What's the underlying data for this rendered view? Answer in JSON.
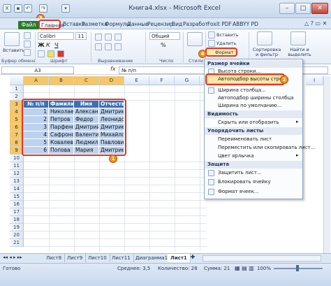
{
  "window": {
    "title": "Книга4.xlsx - Microsoft Excel",
    "min": "–",
    "max": "□",
    "close": "✕"
  },
  "ribbon_tabs": {
    "file": "Файл",
    "items": [
      "Главная",
      "Вставка",
      "Разметка",
      "Формулы",
      "Данные",
      "Рецензир",
      "Вид",
      "Разработ",
      "Foxit PDF",
      "ABBYY PD"
    ]
  },
  "ribbon": {
    "paste": "Вставить",
    "clipboard_group": "Буфер обмена",
    "font_name": "Calibri",
    "font_size": "11",
    "font_group": "Шрифт",
    "align_group": "Выравнивание",
    "number_format": "Общий",
    "number_group": "Число",
    "styles": "Стили",
    "insert": "Вставить",
    "delete": "Удалить",
    "format": "Формат",
    "sort": "Сортировка и фильтр",
    "find": "Найти и выделить",
    "bold": "Ж",
    "italic": "К",
    "underline": "Ч",
    "percent": "%"
  },
  "formula_bar": {
    "name_box": "A3",
    "fx": "fx",
    "value": "№ п/п"
  },
  "columns": [
    "A",
    "B",
    "C",
    "D",
    "E",
    "F",
    "G",
    "H",
    "I"
  ],
  "rows": [
    "1",
    "2",
    "3",
    "4",
    "5",
    "6",
    "7",
    "8",
    "9",
    "10",
    "11",
    "12",
    "13",
    "14",
    "15",
    "16",
    "17",
    "18",
    "19",
    "20",
    "21"
  ],
  "table": {
    "headers": [
      "№ п/п",
      "Фамилия",
      "Имя",
      "Отчество"
    ],
    "rows": [
      [
        "1",
        "Николае",
        "Алексан",
        "Дмитрие"
      ],
      [
        "2",
        "Петров",
        "Федор",
        "Леонидо"
      ],
      [
        "3",
        "Парфено",
        "Дмитрий",
        "Дмитрие"
      ],
      [
        "4",
        "Сафроно",
        "Валенти",
        "Михайло"
      ],
      [
        "5",
        "Ковалев",
        "Людмил",
        "Павлови"
      ],
      [
        "6",
        "Попова",
        "Мария",
        "Дмитрие"
      ]
    ]
  },
  "menu": {
    "sections": {
      "size": "Размер ячейки",
      "visibility": "Видимость",
      "organize": "Упорядочить листы",
      "protect": "Защита"
    },
    "items": {
      "row_height": "Высота строки...",
      "autofit_row": "Автоподбор высоты строки",
      "col_width": "Ширина столбца...",
      "autofit_col": "Автоподбор ширины столбца",
      "default_width": "Ширина по умолчанию...",
      "hide_show": "Скрыть или отобразить",
      "rename": "Переименовать лист",
      "move_copy": "Переместить или скопировать лист...",
      "tab_color": "Цвет ярлычка",
      "protect_sheet": "Защитить лист...",
      "lock_cell": "Блокировать ячейку",
      "format_cells": "Формат ячеек..."
    }
  },
  "badges": [
    "1",
    "2",
    "3",
    "4"
  ],
  "sheets": {
    "items": [
      "Лист8",
      "Лист9",
      "Лист10",
      "Лист11",
      "Диаграмма1",
      "Лист1"
    ],
    "active": "Лист1"
  },
  "status": {
    "ready": "Готово",
    "average": "Среднее: 3,5",
    "count": "Количество: 28",
    "sum": "Сумма: 21",
    "zoom": "100%"
  },
  "colors": {
    "accent_red": "#e2362a",
    "badge_orange": "#f39020",
    "table_header": "#3f6fb5",
    "table_data": "#bcd2ee"
  }
}
